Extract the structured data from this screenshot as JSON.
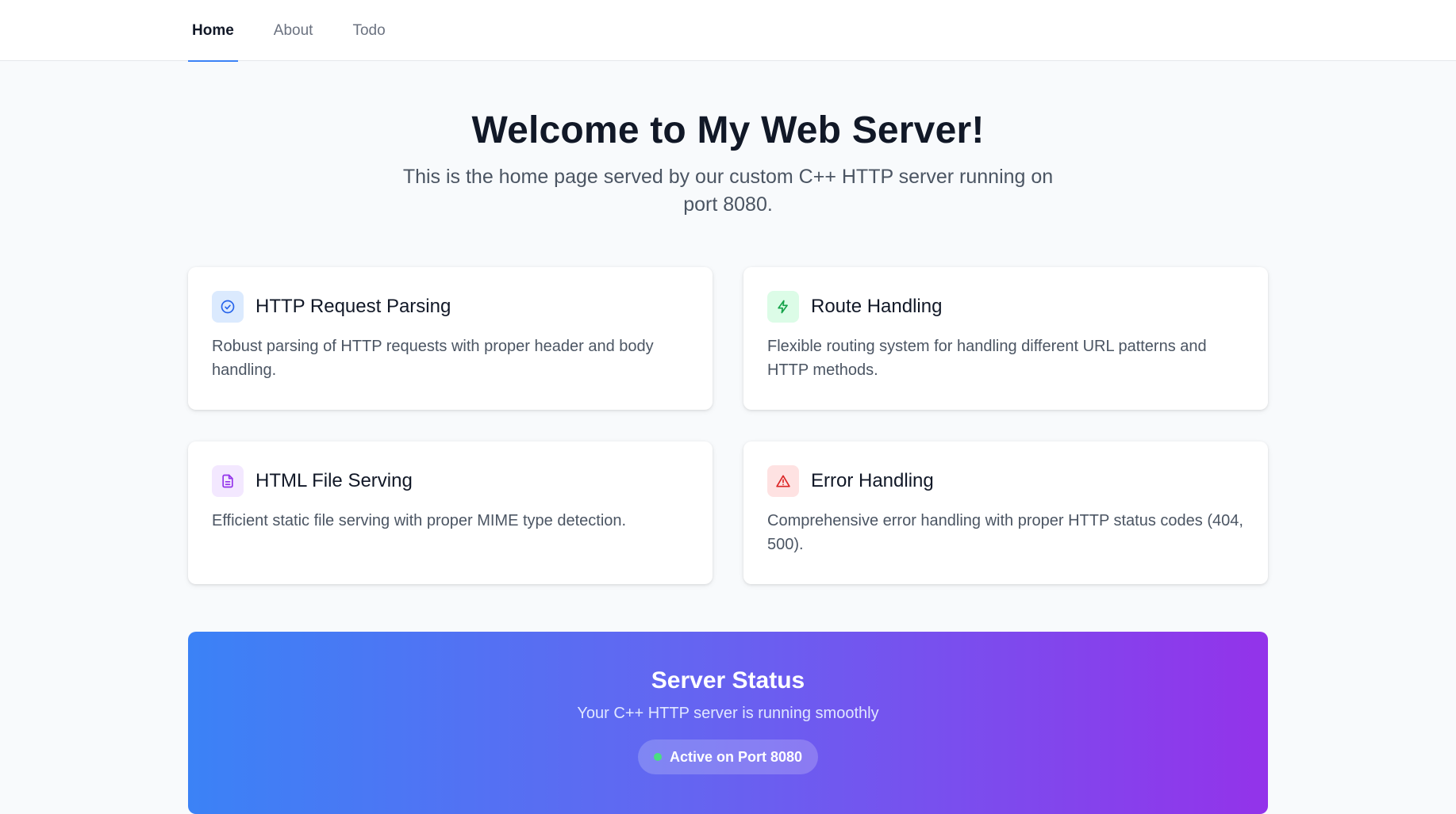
{
  "nav": {
    "items": [
      {
        "label": "Home",
        "active": true
      },
      {
        "label": "About",
        "active": false
      },
      {
        "label": "Todo",
        "active": false
      }
    ],
    "accent_color": "#3b82f6"
  },
  "hero": {
    "title": "Welcome to My Web Server!",
    "subtitle": "This is the home page served by our custom C++ HTTP server running on port 8080."
  },
  "features": [
    {
      "icon": "check-circle-icon",
      "icon_color": "#2563eb",
      "title": "HTTP Request Parsing",
      "description": "Robust parsing of HTTP requests with proper header and body handling."
    },
    {
      "icon": "lightning-icon",
      "icon_color": "#16a34a",
      "title": "Route Handling",
      "description": "Flexible routing system for handling different URL patterns and HTTP methods."
    },
    {
      "icon": "document-icon",
      "icon_color": "#9333ea",
      "title": "HTML File Serving",
      "description": "Efficient static file serving with proper MIME type detection."
    },
    {
      "icon": "warning-triangle-icon",
      "icon_color": "#dc2626",
      "title": "Error Handling",
      "description": "Comprehensive error handling with proper HTTP status codes (404, 500)."
    }
  ],
  "status": {
    "title": "Server Status",
    "subtitle": "Your C++ HTTP server is running smoothly",
    "badge": "Active on Port 8080",
    "gradient_start": "#3b82f6",
    "gradient_end": "#9333ea",
    "indicator_color": "#4ade80"
  }
}
